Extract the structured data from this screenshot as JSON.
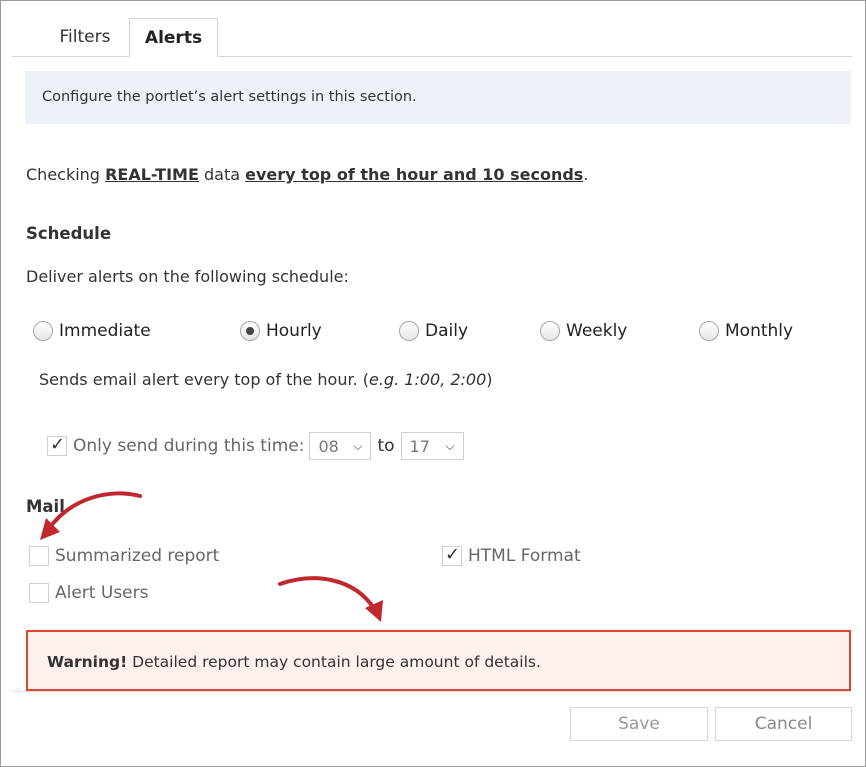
{
  "tabs": [
    {
      "label": "Filters",
      "active": false
    },
    {
      "label": "Alerts",
      "active": true
    }
  ],
  "info_text": "Configure the portlet’s alert settings in this section.",
  "checking": {
    "prefix": "Checking",
    "mode": "REAL-TIME",
    "middle": "data",
    "frequency": "every top of the hour and 10 seconds",
    "suffix": "."
  },
  "schedule": {
    "title": "Schedule",
    "description": "Deliver alerts on the following schedule:",
    "options": [
      {
        "label": "Immediate",
        "selected": false
      },
      {
        "label": "Hourly",
        "selected": true
      },
      {
        "label": "Daily",
        "selected": false
      },
      {
        "label": "Weekly",
        "selected": false
      },
      {
        "label": "Monthly",
        "selected": false
      }
    ],
    "sends_prefix": "Sends email alert every top of the hour. (",
    "sends_example": "e.g. 1:00, 2:00",
    "sends_suffix": ")",
    "only_send_label": "Only send during this time:",
    "only_send_checked": true,
    "from_value": "08",
    "to_label": "to",
    "to_value": "17"
  },
  "mail": {
    "title": "Mail",
    "summarized_report": {
      "label": "Summarized report",
      "checked": false
    },
    "html_format": {
      "label": "HTML Format",
      "checked": true
    },
    "alert_users": {
      "label": "Alert Users",
      "checked": false
    }
  },
  "warning": {
    "strong": "Warning!",
    "text": " Detailed report may contain large amount of details.",
    "border_color": "#d8462f"
  },
  "buttons": {
    "save": "Save",
    "cancel": "Cancel"
  },
  "colors": {
    "annotation_arrow": "#c0282e",
    "info_background": "#edf2f8"
  }
}
